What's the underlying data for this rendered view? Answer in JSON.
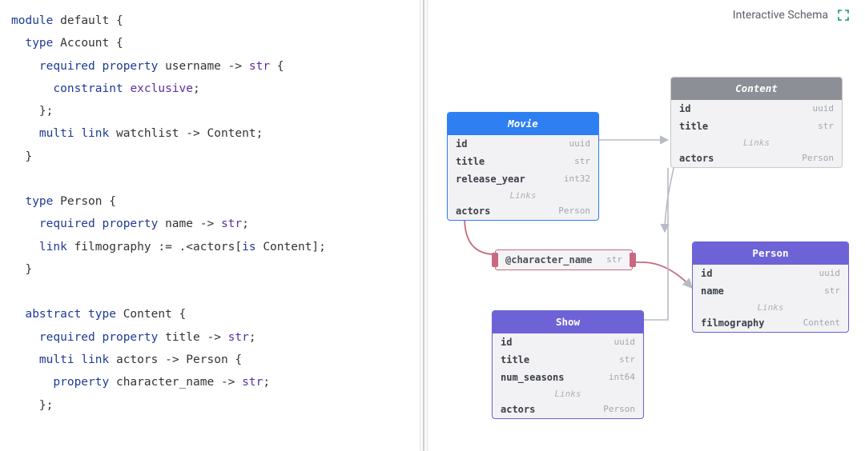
{
  "header": {
    "title": "Interactive Schema"
  },
  "code": {
    "l1a": "module",
    "l1b": "default",
    "l1c": " {",
    "l2a": "type",
    "l2b": "Account",
    "l2c": " {",
    "l3a": "required",
    "l3b": "property",
    "l3c": "username",
    "l3d": "->",
    "l3e": "str",
    "l3f": " {",
    "l4a": "constraint",
    "l4b": "exclusive",
    "l4c": ";",
    "l5": "};",
    "l6a": "multi",
    "l6b": "link",
    "l6c": "watchlist",
    "l6d": "->",
    "l6e": "Content",
    "l6f": ";",
    "l7": "}",
    "l9a": "type",
    "l9b": "Person",
    "l9c": " {",
    "l10a": "required",
    "l10b": "property",
    "l10c": "name",
    "l10d": "->",
    "l10e": "str",
    "l10f": ";",
    "l11a": "link",
    "l11b": "filmography",
    "l11c": ":=",
    "l11d": ".<actors[",
    "l11e": "is",
    "l11f": " Content];",
    "l12": "}",
    "l14a": "abstract",
    "l14b": "type",
    "l14c": "Content",
    "l14d": " {",
    "l15a": "required",
    "l15b": "property",
    "l15c": "title",
    "l15d": "->",
    "l15e": "str",
    "l15f": ";",
    "l16a": "multi",
    "l16b": "link",
    "l16c": "actors",
    "l16d": "->",
    "l16e": "Person",
    "l16f": " {",
    "l17a": "property",
    "l17b": "character_name",
    "l17c": "->",
    "l17d": "str",
    "l17e": ";",
    "l18": "};"
  },
  "schema": {
    "movie": {
      "title": "Movie",
      "rows": [
        {
          "k": "id",
          "t": "uuid"
        },
        {
          "k": "title",
          "t": "str"
        },
        {
          "k": "release_year",
          "t": "int32"
        }
      ],
      "links_label": "Links",
      "links": [
        {
          "k": "actors",
          "t": "Person"
        }
      ]
    },
    "content": {
      "title": "Content",
      "rows": [
        {
          "k": "id",
          "t": "uuid"
        },
        {
          "k": "title",
          "t": "str"
        }
      ],
      "links_label": "Links",
      "links": [
        {
          "k": "actors",
          "t": "Person"
        }
      ]
    },
    "person": {
      "title": "Person",
      "rows": [
        {
          "k": "id",
          "t": "uuid"
        },
        {
          "k": "name",
          "t": "str"
        }
      ],
      "links_label": "Links",
      "links": [
        {
          "k": "filmography",
          "t": "Content"
        }
      ]
    },
    "show": {
      "title": "Show",
      "rows": [
        {
          "k": "id",
          "t": "uuid"
        },
        {
          "k": "title",
          "t": "str"
        },
        {
          "k": "num_seasons",
          "t": "int64"
        }
      ],
      "links_label": "Links",
      "links": [
        {
          "k": "actors",
          "t": "Person"
        }
      ]
    },
    "linkprop": {
      "k": "@character_name",
      "t": "str"
    }
  }
}
